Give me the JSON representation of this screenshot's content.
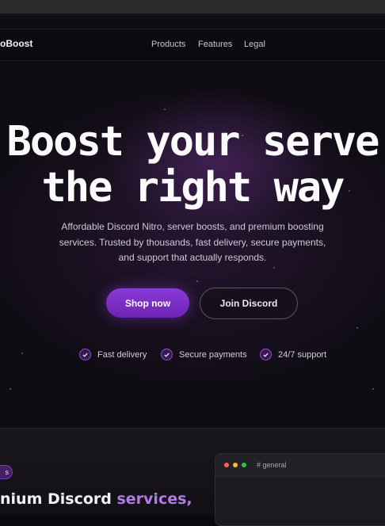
{
  "brand": {
    "logo_text": "oBoost"
  },
  "nav": {
    "items": [
      "Products",
      "Features",
      "Legal"
    ]
  },
  "hero": {
    "headline_line1": "Boost your serve",
    "headline_line2": "the right way",
    "subtitle_line1": "Affordable Discord Nitro, server boosts, and premium boosting",
    "subtitle_line2": "services. Trusted by thousands, fast delivery, secure payments,",
    "subtitle_line3": "and support that actually responds.",
    "primary_button": "Shop now",
    "secondary_button": "Join Discord",
    "features": [
      "Fast delivery",
      "Secure payments",
      "24/7 support"
    ]
  },
  "section2": {
    "pill_text": "s",
    "title_part1": "nium Discord ",
    "title_accent": "services,"
  },
  "preview_window": {
    "channel": "# general",
    "dot_colors": [
      "#ff5f57",
      "#febc2e",
      "#28c840"
    ]
  },
  "colors": {
    "accent": "#7e2fc8",
    "background": "#0b090e",
    "accent_text": "#b27ae8"
  }
}
